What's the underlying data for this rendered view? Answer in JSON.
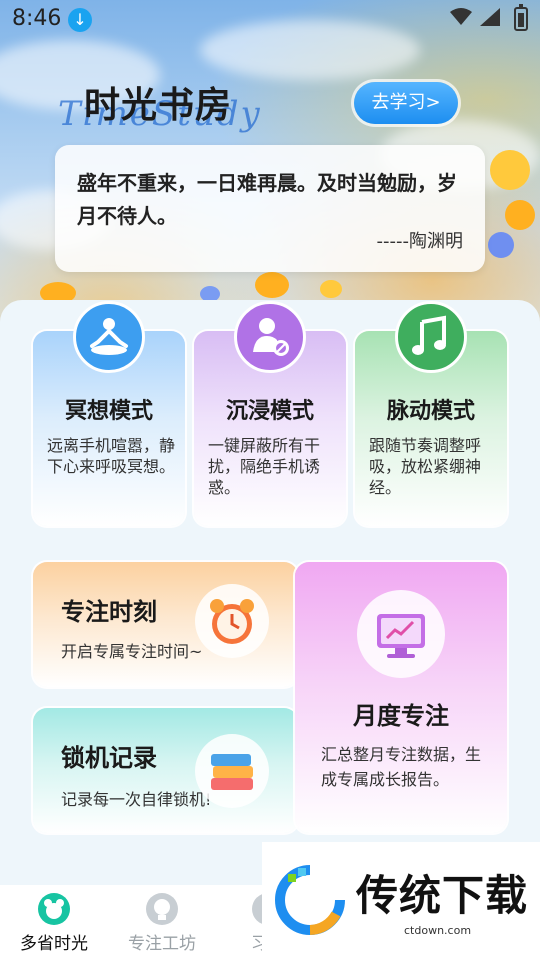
{
  "status_bar": {
    "time": "8:46"
  },
  "header": {
    "title": "时光书房",
    "title_script": "TimeStudy",
    "go_button": "去学习>"
  },
  "quote": {
    "text": "盛年不重来，一日难再晨。及时当勉励，岁月不待人。",
    "author": "-----陶渊明"
  },
  "modes": [
    {
      "title": "冥想模式",
      "desc": "远离手机喧嚣，静下心来呼吸冥想。",
      "icon": "meditation-icon",
      "color": "#3d9ef0"
    },
    {
      "title": "沉浸模式",
      "desc": "一键屏蔽所有干扰，隔绝手机诱惑。",
      "icon": "user-block-icon",
      "color": "#b072e6"
    },
    {
      "title": "脉动模式",
      "desc": "跟随节奏调整呼吸，放松紧绷神经。",
      "icon": "music-note-icon",
      "color": "#3fae5e"
    }
  ],
  "cards": {
    "focus": {
      "title": "专注时刻",
      "desc": "开启专属专注时间~",
      "icon": "alarm-clock-icon"
    },
    "lock": {
      "title": "锁机记录",
      "desc": "记录每一次自律锁机!",
      "icon": "books-icon"
    },
    "monthly": {
      "title": "月度专注",
      "desc": "汇总整月专注数据，生成专属成长报告。",
      "icon": "chart-monitor-icon"
    }
  },
  "tabs": [
    {
      "label": "多省时光",
      "icon": "bear-icon",
      "active": true
    },
    {
      "label": "专注工坊",
      "icon": "bulb-icon",
      "active": false
    },
    {
      "label": "习惯",
      "icon": "habit-icon",
      "active": false
    }
  ],
  "watermark": {
    "text": "传统下载",
    "url": "ctdown.com"
  }
}
